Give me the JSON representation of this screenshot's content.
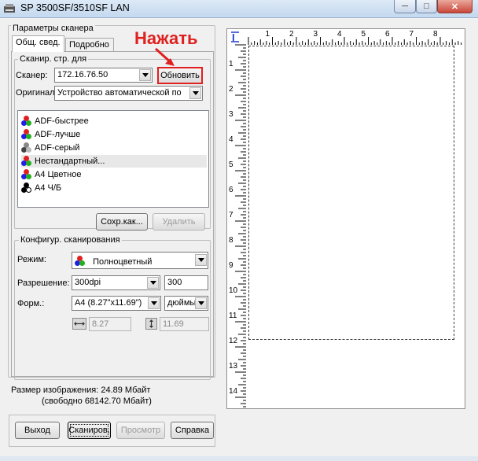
{
  "window": {
    "title": "SP 3500SF/3510SF LAN"
  },
  "scanner_params": {
    "group_label": "Параметры сканера",
    "tabs": [
      "Общ. свед.",
      "Подробно"
    ],
    "scan_for_label": "Сканир. стр. для",
    "scanner_label": "Сканер:",
    "scanner_value": "172.16.76.50",
    "update_button": "Обновить",
    "annotation": "Нажать",
    "original_label": "Оригинал:",
    "original_value": "Устройство автоматической по",
    "presets": [
      {
        "label": "ADF-быстрее",
        "icon": "color-icon"
      },
      {
        "label": "ADF-лучше",
        "icon": "color-icon"
      },
      {
        "label": "ADF-серый",
        "icon": "gray-icon"
      },
      {
        "label": "Нестандартный...",
        "icon": "color-icon"
      },
      {
        "label": "A4 Цветное",
        "icon": "color-icon"
      },
      {
        "label": "A4 Ч/Б",
        "icon": "bw-icon"
      }
    ],
    "save_button": "Сохр.как...",
    "delete_button": "Удалить"
  },
  "scan_config": {
    "group_label": "Конфигур. сканирования",
    "mode_label": "Режим:",
    "mode_value": "Полноцветный",
    "resolution_label": "Разрешение:",
    "resolution_value": "300dpi",
    "resolution_number": "300",
    "format_label": "Форм.:",
    "format_value": "A4 (8.27\"x11.69\")",
    "unit_value": "дюймы",
    "width_value": "8.27",
    "height_value": "11.69"
  },
  "image_size": {
    "line1": "Размер изображения: 24.89 Мбайт",
    "line2": "(свободно 68142.70 Мбайт)"
  },
  "buttons": {
    "exit": "Выход",
    "scan": "Сканиров.",
    "preview": "Просмотр",
    "help": "Справка"
  },
  "ruler": {
    "top": [
      "1",
      "2",
      "3",
      "4",
      "5",
      "6",
      "7",
      "8"
    ],
    "left": [
      "1",
      "2",
      "3",
      "4",
      "5",
      "6",
      "7",
      "8",
      "9",
      "10",
      "11",
      "12",
      "13",
      "14"
    ]
  },
  "colors": {
    "annotation_red": "#e02020",
    "title_gradient": "#c3d8ef"
  }
}
